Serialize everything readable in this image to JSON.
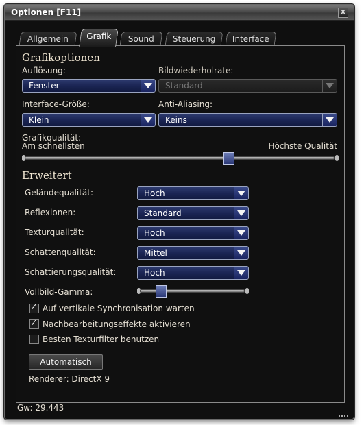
{
  "window": {
    "title": "Optionen  [F11]",
    "close_glyph": "x"
  },
  "tabs": [
    {
      "label": "Allgemein",
      "active": false
    },
    {
      "label": "Grafik",
      "active": true
    },
    {
      "label": "Sound",
      "active": false
    },
    {
      "label": "Steuerung",
      "active": false
    },
    {
      "label": "Interface",
      "active": false
    }
  ],
  "graphics": {
    "heading": "Grafikoptionen",
    "resolution": {
      "label": "Auflösung:",
      "value": "Fenster"
    },
    "refresh": {
      "label": "Bildwiederholrate:",
      "value": "Standard",
      "disabled": true
    },
    "interface_size": {
      "label": "Interface-Größe:",
      "value": "Klein"
    },
    "anti_aliasing": {
      "label": "Anti-Aliasing:",
      "value": "Keins"
    },
    "quality": {
      "label": "Grafikqualität:",
      "min_label": "Am schnellsten",
      "max_label": "Höchste Qualität",
      "level": 0.66
    }
  },
  "advanced": {
    "heading": "Erweitert",
    "terrain": {
      "label": "Geländequalität:",
      "value": "Hoch"
    },
    "reflections": {
      "label": "Reflexionen:",
      "value": "Standard"
    },
    "texture": {
      "label": "Texturqualität:",
      "value": "Hoch"
    },
    "shadow": {
      "label": "Schattenqualität:",
      "value": "Mittel"
    },
    "shading": {
      "label": "Schattierungsqualität:",
      "value": "Hoch"
    },
    "gamma": {
      "label": "Vollbild-Gamma:",
      "level": 0.2
    },
    "vsync": {
      "label": "Auf vertikale Synchronisation warten",
      "checked": true
    },
    "postfx": {
      "label": "Nachbearbeitungseffekte aktivieren",
      "checked": true
    },
    "texfilter": {
      "label": "Besten Texturfilter benutzen",
      "checked": false
    },
    "auto_button": "Automatisch",
    "renderer": "Renderer: DirectX 9"
  },
  "footer": {
    "version": "Gw: 29.443"
  },
  "colors": {
    "accent": "#1b2554",
    "background": "#0f0f0f",
    "border": "#8a8a8a"
  }
}
